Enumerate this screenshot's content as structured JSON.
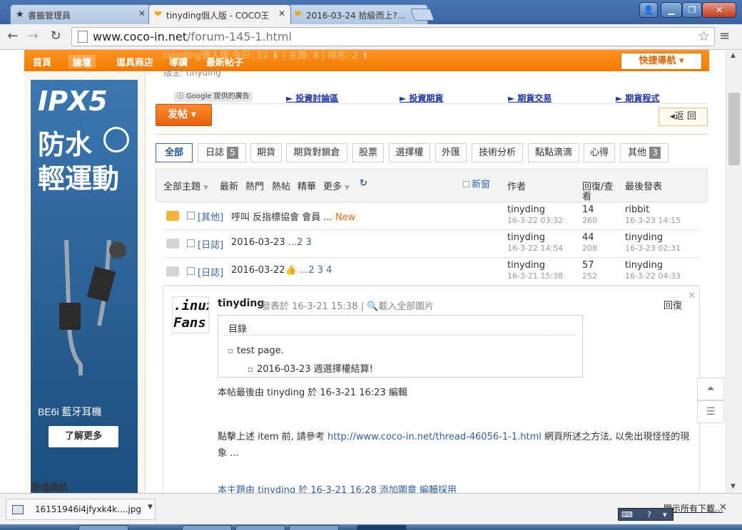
{
  "browser": {
    "tabs": [
      {
        "title": "書籤管理員",
        "icon": "star-icon",
        "active": false
      },
      {
        "title": "tinyding個人版 - COCO王",
        "icon": "heart-logo-icon",
        "active": true
      },
      {
        "title": "2016-03-24 拾級而上?...",
        "icon": "heart-logo-icon",
        "active": false
      }
    ],
    "url_host": "www.coco-in.net",
    "url_path": "/forum-145-1.html"
  },
  "site": {
    "nav": [
      "首頁",
      "論壇",
      "道具商店",
      "導讀",
      "最新帖子"
    ],
    "nav_active": "論壇",
    "quick_nav": "快捷導航 ▾",
    "moderator": "版主: tinyding",
    "faded_header": "tinyding個人版   今日: 12 ⬇  |  主題: 8  |  排名: 2 ⬆"
  },
  "sidebar": {
    "ad_brand": "IPX5",
    "ad_line2": "防水",
    "ad_line3": "輕運動",
    "ad_model": "BE6i 藍牙耳機",
    "ad_cta": "了解更多",
    "block_nav": "版塊導航"
  },
  "google_ads": {
    "badge": "ⓘ Google 提供的廣告",
    "links": [
      "► 投資討論區",
      "► 投資期貨",
      "► 期貨交易",
      "► 期貨程式"
    ]
  },
  "actions": {
    "post_label": "发帖 ▾",
    "back_label": "◂返 回"
  },
  "categories": [
    {
      "label": "全部",
      "count": "",
      "selected": true
    },
    {
      "label": "日誌",
      "count": "5",
      "selected": false
    },
    {
      "label": "期貨",
      "count": "",
      "selected": false
    },
    {
      "label": "期貨對鎖倉",
      "count": "",
      "selected": false
    },
    {
      "label": "股票",
      "count": "",
      "selected": false
    },
    {
      "label": "選擇權",
      "count": "",
      "selected": false
    },
    {
      "label": "外匯",
      "count": "",
      "selected": false
    },
    {
      "label": "技術分析",
      "count": "",
      "selected": false
    },
    {
      "label": "點點滴滴",
      "count": "",
      "selected": false
    },
    {
      "label": "心得",
      "count": "",
      "selected": false
    },
    {
      "label": "其他",
      "count": "3",
      "selected": false
    }
  ],
  "list_header": {
    "all_topics": "全部主題",
    "filters": [
      "最新",
      "熱門",
      "熱帖",
      "精華",
      "更多"
    ],
    "refresh_icon": "refresh-icon",
    "new_window": "新窗",
    "author": "作者",
    "replies_views_1": "回復/查",
    "replies_views_2": "看",
    "last_post": "最後發表"
  },
  "threads": [
    {
      "category": "[其他]",
      "title": "呼叫 反指標協會 會員 ...",
      "tag": "New",
      "pages": "",
      "author": "tinyding",
      "author_date": "16-3-22 03:32",
      "replies": "14",
      "views": "260",
      "last_by": "ribbit",
      "last_date": "16-3-23 14:15",
      "icon_color": "#f7b53b"
    },
    {
      "category": "[日誌]",
      "title": "2016-03-23",
      "tag": "",
      "pages": " ...2  3",
      "author": "tinyding",
      "author_date": "16-3-22 14:54",
      "replies": "44",
      "views": "208",
      "last_by": "tinyding",
      "last_date": "16-3-23 02:31",
      "icon_color": "#d5d5d5"
    },
    {
      "category": "[日誌]",
      "title": "2016-03-22",
      "tag": "",
      "pages": " ...2  3  4",
      "author": "tinyding",
      "author_date": "16-3-21 15:38",
      "replies": "57",
      "views": "252",
      "last_by": "tinyding",
      "last_date": "16-3-22 04:33",
      "icon_color": "#d5d5d5"
    }
  ],
  "post": {
    "avatar_line1": ".inux",
    "avatar_line2": "Fans",
    "user": "tinyding",
    "posted_label": "發表於 16-3-21 15:38 | 🔍載入全部圖片",
    "reply": "回復",
    "toc_title": "目錄",
    "toc_items": [
      "test page.",
      "2016-03-23 週選擇權結算!"
    ],
    "edit_note": "本帖最後由 tinyding 於 16-3-21 16:23 編輯",
    "para_before_link": "點擊上述 item 前, 請參考 ",
    "para_link": "http://www.coco-in.net/thread-46056-1-1.html",
    "para_after_link": " 網頁所述之方法, 以免出現怪怪的現象 ...",
    "footer_note": "本主題由 tinyding 於 16-3-21 16:28 添加圖章 編輯採用"
  },
  "downloads": {
    "file_name": "16151946i4jfyxk4k....jpg",
    "show_all": "顯示所有下載...",
    "close": "✕"
  },
  "colors": {
    "orange": "#f58a1f",
    "link_blue": "#2f5fa8",
    "chrome_blue": "#4a77b3"
  }
}
